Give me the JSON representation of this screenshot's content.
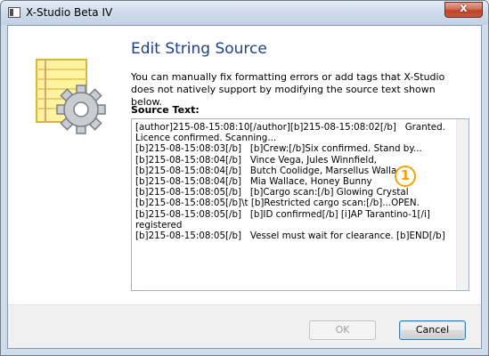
{
  "window": {
    "title": "X-Studio Beta IV",
    "close_label": "x"
  },
  "dialog": {
    "heading": "Edit String Source",
    "description": "You can manually fix formatting errors or add tags that X-Studio does not natively support by modifying the source text shown below.",
    "source_label": "Source Text:",
    "source_text": "[author]215-08-15:08:10[/author][b]215-08-15:08:02[/b]   Granted. Licence confirmed. Scanning...\n[b]215-08-15:08:03[/b]   [b]Crew:[/b]Six confirmed. Stand by...\n[b]215-08-15:08:04[/b]   Vince Vega, Jules Winnfield,\n[b]215-08-15:08:04[/b]   Butch Coolidge, Marsellus Wallace,\n[b]215-08-15:08:04[/b]   Mia Wallace, Honey Bunny\n[b]215-08-15:08:05[/b]   [b]Cargo scan:[/b] Glowing Crystal\n[b]215-08-15:08:05[/b]\\t [b]Restricted cargo scan:[/b]...OPEN.\n[b]215-08-15:08:05[/b]   [b]ID confirmed[/b] [i]AP Tarantino-1[/i] registered\n[b]215-08-15:08:05[/b]   Vessel must wait for clearance. [b]END[/b]",
    "annotation_number": "1"
  },
  "buttons": {
    "ok": "OK",
    "cancel": "Cancel"
  },
  "icons": {
    "dialog_icon": "notepad-gear-icon",
    "app_icon": "window-icon",
    "close": "close-icon"
  },
  "colors": {
    "heading": "#1e3f8a",
    "badge": "#f4a300",
    "close_button": "#c24a30"
  }
}
